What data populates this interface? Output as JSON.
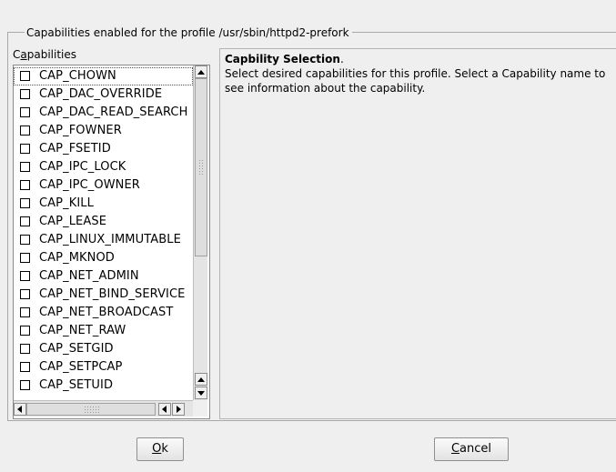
{
  "group": {
    "title": "Capabilities enabled for the profile /usr/sbin/httpd2-prefork"
  },
  "list": {
    "label_mnemonic": "a",
    "label_prefix": "C",
    "label_suffix": "pabilities",
    "items": [
      {
        "label": "CAP_CHOWN",
        "checked": false
      },
      {
        "label": "CAP_DAC_OVERRIDE",
        "checked": false
      },
      {
        "label": "CAP_DAC_READ_SEARCH",
        "checked": false
      },
      {
        "label": "CAP_FOWNER",
        "checked": false
      },
      {
        "label": "CAP_FSETID",
        "checked": false
      },
      {
        "label": "CAP_IPC_LOCK",
        "checked": false
      },
      {
        "label": "CAP_IPC_OWNER",
        "checked": false
      },
      {
        "label": "CAP_KILL",
        "checked": false
      },
      {
        "label": "CAP_LEASE",
        "checked": false
      },
      {
        "label": "CAP_LINUX_IMMUTABLE",
        "checked": false
      },
      {
        "label": "CAP_MKNOD",
        "checked": false
      },
      {
        "label": "CAP_NET_ADMIN",
        "checked": false
      },
      {
        "label": "CAP_NET_BIND_SERVICE",
        "checked": false
      },
      {
        "label": "CAP_NET_BROADCAST",
        "checked": false
      },
      {
        "label": "CAP_NET_RAW",
        "checked": false
      },
      {
        "label": "CAP_SETGID",
        "checked": false
      },
      {
        "label": "CAP_SETPCAP",
        "checked": false
      },
      {
        "label": "CAP_SETUID",
        "checked": false
      }
    ]
  },
  "help": {
    "title": "Capbility Selection",
    "title_suffix": ".",
    "body": "Select desired capabilities for this profile. Select a Capability name to see information about the capability."
  },
  "buttons": {
    "ok_mnemonic": "O",
    "ok_rest": "k",
    "cancel_mnemonic": "C",
    "cancel_rest": "ancel"
  },
  "icons": {
    "scroll_up": "arrow-up-icon",
    "scroll_down": "arrow-down-icon",
    "scroll_left": "arrow-left-icon",
    "scroll_right": "arrow-right-icon"
  }
}
